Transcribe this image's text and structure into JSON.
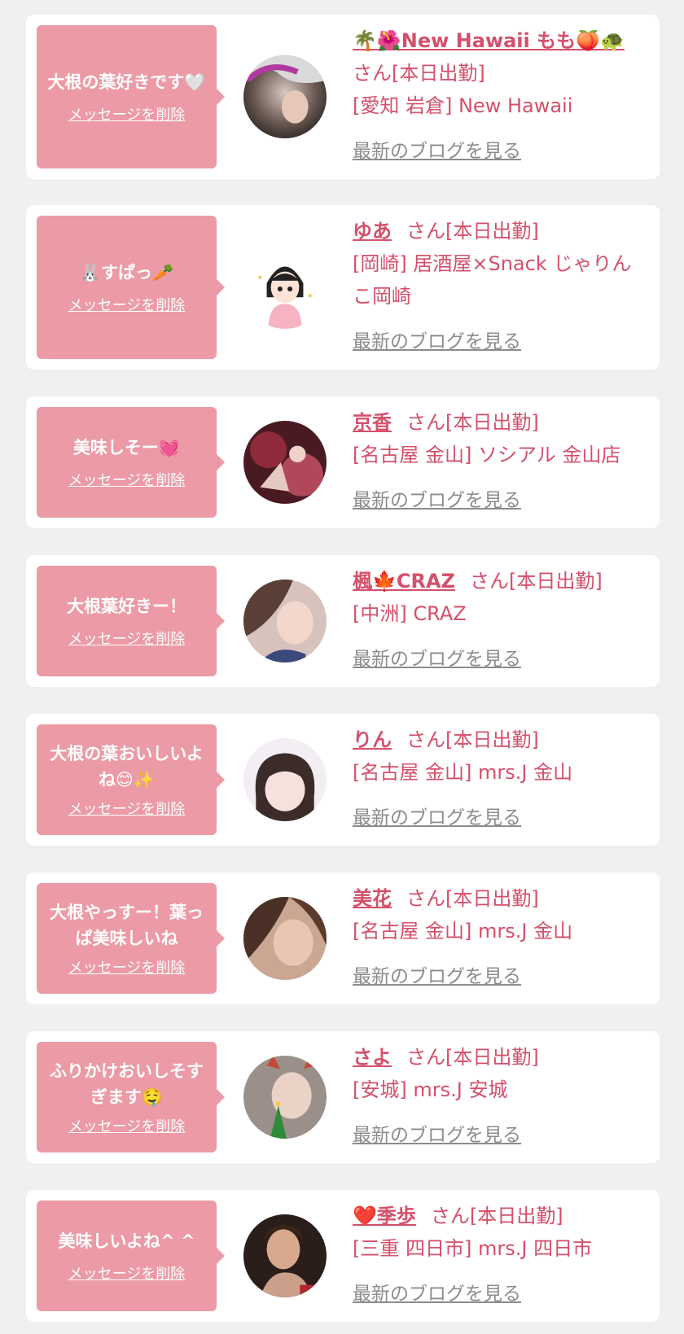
{
  "items": [
    {
      "message": "大根の葉好きです🤍",
      "delete_label": "メッセージを削除",
      "name": "🌴🌺New Hawaii もも🍑🐢",
      "suffix": "さん[本日出勤]",
      "shop": "[愛知 岩倉] New Hawaii",
      "blog_label": "最新のブログを見る",
      "avatar": "avatar-momo"
    },
    {
      "message": "🐰すぱっ🥕",
      "delete_label": "メッセージを削除",
      "name": "ゆあ",
      "suffix": "さん[本日出勤]",
      "shop": "[岡崎] 居酒屋×Snack じゃりんこ岡崎",
      "blog_label": "最新のブログを見る",
      "avatar": "avatar-yua-illustration"
    },
    {
      "message": "美味しそー💓",
      "delete_label": "メッセージを削除",
      "name": "京香",
      "suffix": "さん[本日出勤]",
      "shop": "[名古屋 金山] ソシアル 金山店",
      "blog_label": "最新のブログを見る",
      "avatar": "avatar-kyoka"
    },
    {
      "message": "大根葉好きー！",
      "delete_label": "メッセージを削除",
      "name": "楓🍁CRAZ",
      "suffix": "さん[本日出勤]",
      "shop": "[中洲] CRAZ",
      "blog_label": "最新のブログを見る",
      "avatar": "avatar-kaede"
    },
    {
      "message": "大根の葉おいしいよね😊✨",
      "delete_label": "メッセージを削除",
      "name": "りん",
      "suffix": "さん[本日出勤]",
      "shop": "[名古屋 金山] mrs.J 金山",
      "blog_label": "最新のブログを見る",
      "avatar": "avatar-rin"
    },
    {
      "message": "大根やっすー！葉っぱ美味しいね",
      "delete_label": "メッセージを削除",
      "name": "美花",
      "suffix": "さん[本日出勤]",
      "shop": "[名古屋 金山] mrs.J 金山",
      "blog_label": "最新のブログを見る",
      "avatar": "avatar-mika"
    },
    {
      "message": "ふりかけおいしそすぎます🤤",
      "delete_label": "メッセージを削除",
      "name": "さよ",
      "suffix": "さん[本日出勤]",
      "shop": "[安城] mrs.J 安城",
      "blog_label": "最新のブログを見る",
      "avatar": "avatar-sayo"
    },
    {
      "message": "美味しいよね^ ^",
      "delete_label": "メッセージを削除",
      "name": "❤️季歩",
      "suffix": "さん[本日出勤]",
      "shop": "[三重 四日市] mrs.J 四日市",
      "blog_label": "最新のブログを見る",
      "avatar": "avatar-kiho"
    }
  ]
}
